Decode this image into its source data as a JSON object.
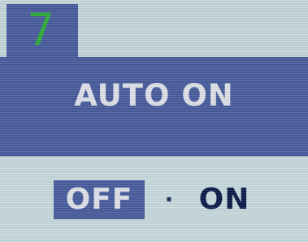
{
  "osd": {
    "step_number": "7",
    "title": "AUTO ON",
    "options": {
      "off_label": "OFF",
      "separator": "·",
      "on_label": "ON",
      "selected": "OFF"
    }
  },
  "colors": {
    "screen_background": "#c9dbe0",
    "accent_band": "#4a5e9e",
    "step_number_color": "#2fae3a",
    "highlight_text": "#dfe3ea",
    "option_text": "#0c1c4c"
  }
}
